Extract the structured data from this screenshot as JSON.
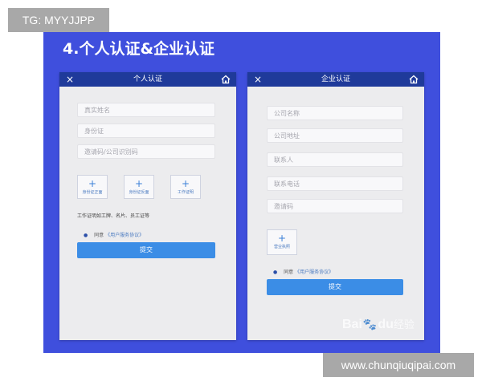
{
  "watermark_tag": "TG: MYYJJPP",
  "watermark_url": "www.chunqiuqipai.com",
  "slide": {
    "title": "4.个人认证&企业认证"
  },
  "personal": {
    "header_title": "个人认证",
    "fields": [
      {
        "placeholder": "真实姓名"
      },
      {
        "placeholder": "身份证"
      },
      {
        "placeholder": "邀请码/公司识别码"
      }
    ],
    "uploads": [
      {
        "caption": "身份证正面"
      },
      {
        "caption": "身份证反面"
      },
      {
        "caption": "工作证明"
      }
    ],
    "hint": "工作证明如工牌、名片、员工证等",
    "agree_prefix": "同意",
    "agree_link": "《用户服务协议》",
    "submit": "提交"
  },
  "enterprise": {
    "header_title": "企业认证",
    "fields": [
      {
        "placeholder": "公司名称"
      },
      {
        "placeholder": "公司地址"
      },
      {
        "placeholder": "联系人"
      },
      {
        "placeholder": "联系电话"
      },
      {
        "placeholder": "邀请码"
      }
    ],
    "uploads": [
      {
        "caption": "营业执照"
      }
    ],
    "agree_prefix": "同意",
    "agree_link": "《用户服务协议》",
    "submit": "提交"
  },
  "baidu_mark": {
    "bai": "Bai",
    "paw": "🐾",
    "du": "du",
    "jingyan": "经验"
  },
  "icons": {
    "close": "×",
    "plus": "+",
    "dot": "●"
  },
  "colors": {
    "slide_bg": "#3f4fdd",
    "header_bg": "#1f3a9a",
    "submit_bg": "#3b8de6",
    "badge_bg": "#a8a8a8"
  }
}
